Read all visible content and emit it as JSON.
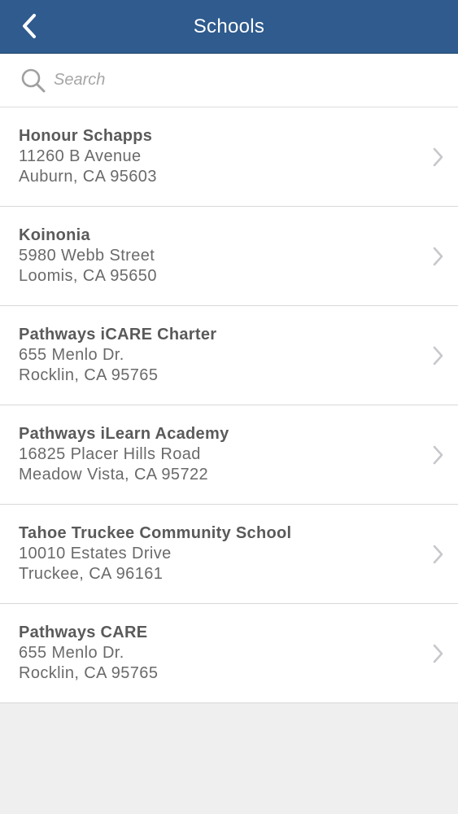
{
  "header": {
    "title": "Schools"
  },
  "search": {
    "placeholder": "Search"
  },
  "schools": [
    {
      "name": "Honour Schapps",
      "address1": "11260 B Avenue",
      "address2": "Auburn, CA 95603"
    },
    {
      "name": "Koinonia",
      "address1": "5980 Webb Street",
      "address2": "Loomis, CA 95650"
    },
    {
      "name": "Pathways iCARE Charter",
      "address1": "655 Menlo Dr.",
      "address2": "Rocklin, CA 95765"
    },
    {
      "name": "Pathways iLearn Academy",
      "address1": "16825 Placer Hills Road",
      "address2": "Meadow Vista, CA 95722"
    },
    {
      "name": "Tahoe Truckee Community School",
      "address1": "10010 Estates Drive",
      "address2": "Truckee, CA 96161"
    },
    {
      "name": "Pathways CARE",
      "address1": "655 Menlo Dr.",
      "address2": "Rocklin, CA 95765"
    }
  ],
  "colors": {
    "navbar": "#2f5b8e",
    "background": "#efeff0",
    "row_text": "#5a5a5a",
    "chevron": "#c7c7cc"
  },
  "icons": {
    "back": "back-chevron-icon",
    "search": "search-icon",
    "row": "chevron-right-icon"
  }
}
